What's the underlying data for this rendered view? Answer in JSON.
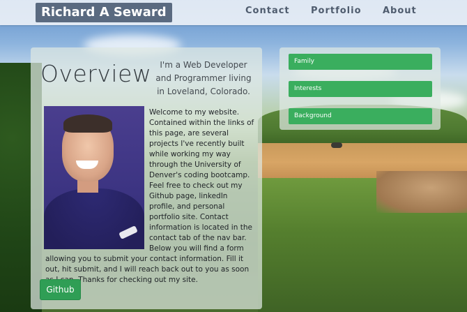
{
  "navbar": {
    "brand": "Richard A Seward",
    "links": [
      "Contact",
      "Portfolio",
      "About"
    ]
  },
  "overview": {
    "title": "Overview",
    "intro": "I'm a Web Developer and Programmer living in Loveland, Colorado.",
    "bio": "Welcome to my website. Contained within the links of this page, are several projects I've recently built while working my way through the University of Denver's coding bootcamp. Feel free to check out my Github page, linkedIn profile, and personal portfolio site. Contact information is located in the contact tab of the nav bar. Below you will find a form allowing you to submit your contact information. Fill it out, hit submit, and I will reach back out to you as soon as I can. Thanks for checking out my site.",
    "github_label": "Github"
  },
  "side_panel": {
    "buttons": [
      "Family",
      "Interests",
      "Background"
    ]
  },
  "colors": {
    "accent_green": "#3aae5e",
    "brand_bg": "#5a6a80"
  },
  "icons": {
    "photo": "profile-photo"
  }
}
